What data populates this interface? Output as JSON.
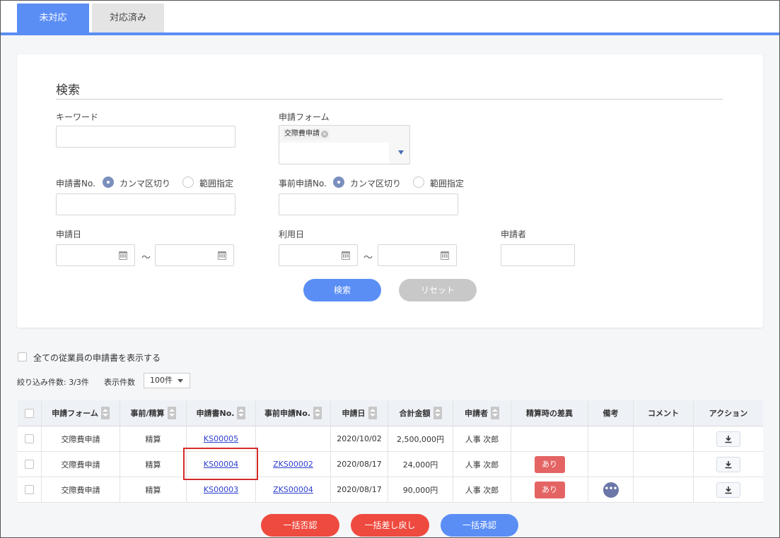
{
  "tabs": [
    {
      "label": "未対応",
      "active": true
    },
    {
      "label": "対応済み",
      "active": false
    }
  ],
  "search": {
    "title": "検索",
    "keyword_label": "キーワード",
    "keyword_value": "",
    "form_label": "申請フォーム",
    "form_tag": "交際費申請",
    "app_no_label": "申請書No.",
    "app_no_opt1": "カンマ区切り",
    "app_no_opt2": "範囲指定",
    "pre_no_label": "事前申請No.",
    "pre_no_opt1": "カンマ区切り",
    "pre_no_opt2": "範囲指定",
    "app_date_label": "申請日",
    "use_date_label": "利用日",
    "applicant_label": "申請者",
    "tilde": "～",
    "search_button": "検索",
    "reset_button": "リセット"
  },
  "filters": {
    "show_all_label": "全ての従業員の申請書を表示する",
    "count_label": "絞り込み件数: 3/3件",
    "perpage_label": "表示件数",
    "perpage_value": "100件"
  },
  "table": {
    "headers": {
      "form": "申請フォーム",
      "type": "事前/精算",
      "app_no": "申請書No.",
      "pre_no": "事前申請No.",
      "date": "申請日",
      "amount": "合計金額",
      "applicant": "申請者",
      "diff": "精算時の差異",
      "note": "備考",
      "comment": "コメント",
      "action": "アクション"
    },
    "rows": [
      {
        "form": "交際費申請",
        "type": "精算",
        "app_no": "KS00005",
        "pre_no": "",
        "date": "2020/10/02",
        "amount": "2,500,000円",
        "applicant": "人事 次郎",
        "diff": "",
        "note": false
      },
      {
        "form": "交際費申請",
        "type": "精算",
        "app_no": "KS00004",
        "pre_no": "ZKS00002",
        "date": "2020/08/17",
        "amount": "24,000円",
        "applicant": "人事 次郎",
        "diff": "あり",
        "note": false
      },
      {
        "form": "交際費申請",
        "type": "精算",
        "app_no": "KS00003",
        "pre_no": "ZKS00004",
        "date": "2020/08/17",
        "amount": "90,000円",
        "applicant": "人事 次郎",
        "diff": "あり",
        "note": true
      }
    ]
  },
  "actions": {
    "reject_all": "一括否認",
    "sendback_all": "一括差し戻し",
    "approve_all": "一括承認"
  },
  "colors": {
    "accent": "#5b8ef5",
    "danger": "#ef4a3f",
    "badge": "#e46464",
    "highlight": "#d62b2b"
  }
}
